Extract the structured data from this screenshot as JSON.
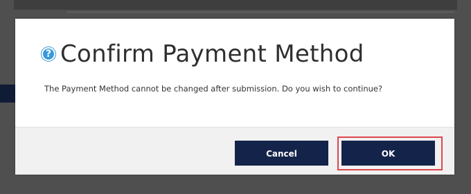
{
  "dialog": {
    "title": "Confirm Payment Method",
    "message": "The Payment Method cannot be changed after submission. Do you wish to continue?",
    "help_icon": {
      "name": "question-circle-icon",
      "glyph": "?"
    },
    "buttons": {
      "cancel_label": "Cancel",
      "ok_label": "OK"
    }
  },
  "colors": {
    "button_bg": "#14234a",
    "accent_icon": "#3a9ad9",
    "highlight": "#e0454e",
    "overlay": "#4f4f4f"
  }
}
